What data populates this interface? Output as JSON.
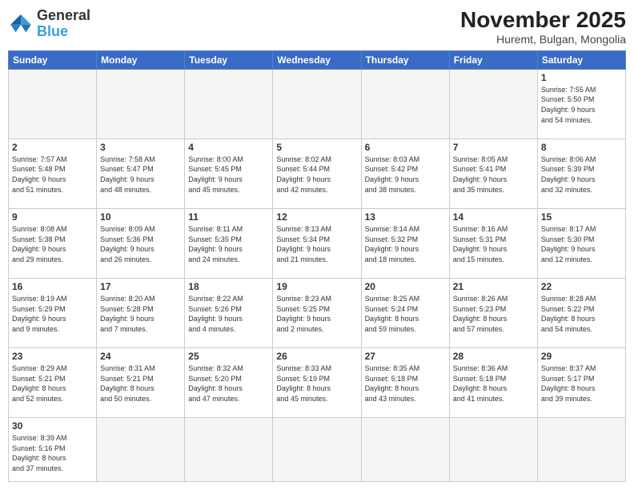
{
  "logo": {
    "text_general": "General",
    "text_blue": "Blue"
  },
  "header": {
    "month": "November 2025",
    "location": "Huremt, Bulgan, Mongolia"
  },
  "days_of_week": [
    "Sunday",
    "Monday",
    "Tuesday",
    "Wednesday",
    "Thursday",
    "Friday",
    "Saturday"
  ],
  "weeks": [
    [
      {
        "day": null,
        "info": null
      },
      {
        "day": null,
        "info": null
      },
      {
        "day": null,
        "info": null
      },
      {
        "day": null,
        "info": null
      },
      {
        "day": null,
        "info": null
      },
      {
        "day": null,
        "info": null
      },
      {
        "day": "1",
        "info": "Sunrise: 7:55 AM\nSunset: 5:50 PM\nDaylight: 9 hours\nand 54 minutes."
      }
    ],
    [
      {
        "day": "2",
        "info": "Sunrise: 7:57 AM\nSunset: 5:48 PM\nDaylight: 9 hours\nand 51 minutes."
      },
      {
        "day": "3",
        "info": "Sunrise: 7:58 AM\nSunset: 5:47 PM\nDaylight: 9 hours\nand 48 minutes."
      },
      {
        "day": "4",
        "info": "Sunrise: 8:00 AM\nSunset: 5:45 PM\nDaylight: 9 hours\nand 45 minutes."
      },
      {
        "day": "5",
        "info": "Sunrise: 8:02 AM\nSunset: 5:44 PM\nDaylight: 9 hours\nand 42 minutes."
      },
      {
        "day": "6",
        "info": "Sunrise: 8:03 AM\nSunset: 5:42 PM\nDaylight: 9 hours\nand 38 minutes."
      },
      {
        "day": "7",
        "info": "Sunrise: 8:05 AM\nSunset: 5:41 PM\nDaylight: 9 hours\nand 35 minutes."
      },
      {
        "day": "8",
        "info": "Sunrise: 8:06 AM\nSunset: 5:39 PM\nDaylight: 9 hours\nand 32 minutes."
      }
    ],
    [
      {
        "day": "9",
        "info": "Sunrise: 8:08 AM\nSunset: 5:38 PM\nDaylight: 9 hours\nand 29 minutes."
      },
      {
        "day": "10",
        "info": "Sunrise: 8:09 AM\nSunset: 5:36 PM\nDaylight: 9 hours\nand 26 minutes."
      },
      {
        "day": "11",
        "info": "Sunrise: 8:11 AM\nSunset: 5:35 PM\nDaylight: 9 hours\nand 24 minutes."
      },
      {
        "day": "12",
        "info": "Sunrise: 8:13 AM\nSunset: 5:34 PM\nDaylight: 9 hours\nand 21 minutes."
      },
      {
        "day": "13",
        "info": "Sunrise: 8:14 AM\nSunset: 5:32 PM\nDaylight: 9 hours\nand 18 minutes."
      },
      {
        "day": "14",
        "info": "Sunrise: 8:16 AM\nSunset: 5:31 PM\nDaylight: 9 hours\nand 15 minutes."
      },
      {
        "day": "15",
        "info": "Sunrise: 8:17 AM\nSunset: 5:30 PM\nDaylight: 9 hours\nand 12 minutes."
      }
    ],
    [
      {
        "day": "16",
        "info": "Sunrise: 8:19 AM\nSunset: 5:29 PM\nDaylight: 9 hours\nand 9 minutes."
      },
      {
        "day": "17",
        "info": "Sunrise: 8:20 AM\nSunset: 5:28 PM\nDaylight: 9 hours\nand 7 minutes."
      },
      {
        "day": "18",
        "info": "Sunrise: 8:22 AM\nSunset: 5:26 PM\nDaylight: 9 hours\nand 4 minutes."
      },
      {
        "day": "19",
        "info": "Sunrise: 8:23 AM\nSunset: 5:25 PM\nDaylight: 9 hours\nand 2 minutes."
      },
      {
        "day": "20",
        "info": "Sunrise: 8:25 AM\nSunset: 5:24 PM\nDaylight: 8 hours\nand 59 minutes."
      },
      {
        "day": "21",
        "info": "Sunrise: 8:26 AM\nSunset: 5:23 PM\nDaylight: 8 hours\nand 57 minutes."
      },
      {
        "day": "22",
        "info": "Sunrise: 8:28 AM\nSunset: 5:22 PM\nDaylight: 8 hours\nand 54 minutes."
      }
    ],
    [
      {
        "day": "23",
        "info": "Sunrise: 8:29 AM\nSunset: 5:21 PM\nDaylight: 8 hours\nand 52 minutes."
      },
      {
        "day": "24",
        "info": "Sunrise: 8:31 AM\nSunset: 5:21 PM\nDaylight: 8 hours\nand 50 minutes."
      },
      {
        "day": "25",
        "info": "Sunrise: 8:32 AM\nSunset: 5:20 PM\nDaylight: 8 hours\nand 47 minutes."
      },
      {
        "day": "26",
        "info": "Sunrise: 8:33 AM\nSunset: 5:19 PM\nDaylight: 8 hours\nand 45 minutes."
      },
      {
        "day": "27",
        "info": "Sunrise: 8:35 AM\nSunset: 5:18 PM\nDaylight: 8 hours\nand 43 minutes."
      },
      {
        "day": "28",
        "info": "Sunrise: 8:36 AM\nSunset: 5:18 PM\nDaylight: 8 hours\nand 41 minutes."
      },
      {
        "day": "29",
        "info": "Sunrise: 8:37 AM\nSunset: 5:17 PM\nDaylight: 8 hours\nand 39 minutes."
      }
    ],
    [
      {
        "day": "30",
        "info": "Sunrise: 8:39 AM\nSunset: 5:16 PM\nDaylight: 8 hours\nand 37 minutes."
      },
      {
        "day": null,
        "info": null
      },
      {
        "day": null,
        "info": null
      },
      {
        "day": null,
        "info": null
      },
      {
        "day": null,
        "info": null
      },
      {
        "day": null,
        "info": null
      },
      {
        "day": null,
        "info": null
      }
    ]
  ]
}
